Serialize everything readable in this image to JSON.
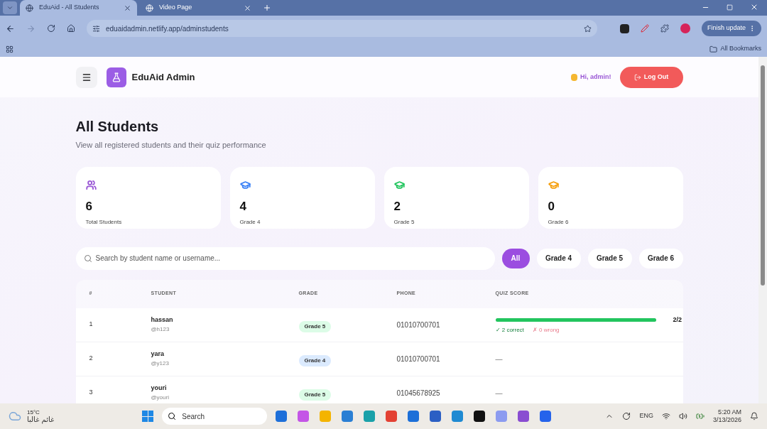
{
  "browser": {
    "tabs": [
      {
        "title": "EduAid - All Students",
        "selected": true
      },
      {
        "title": "Video Page",
        "selected": false
      }
    ],
    "address": "eduaidadmin.netlify.app/adminstudents",
    "update_button": "Finish update",
    "bookmarks": "All Bookmarks"
  },
  "header": {
    "brand": "EduAid Admin",
    "greeting": "Hi, admin!",
    "logout": "Log Out"
  },
  "page": {
    "title": "All Students",
    "subtitle": "View all registered students and their quiz performance"
  },
  "stats": [
    {
      "value": "6",
      "label": "Total Students",
      "color": "#9b59d6",
      "kind": "users"
    },
    {
      "value": "4",
      "label": "Grade 4",
      "color": "#3b82f6",
      "kind": "grad"
    },
    {
      "value": "2",
      "label": "Grade 5",
      "color": "#22c55e",
      "kind": "grad"
    },
    {
      "value": "0",
      "label": "Grade 6",
      "color": "#f59e0b",
      "kind": "grad"
    }
  ],
  "search": {
    "placeholder": "Search by student name or username..."
  },
  "filters": [
    {
      "label": "All",
      "selected": true
    },
    {
      "label": "Grade 4",
      "selected": false
    },
    {
      "label": "Grade 5",
      "selected": false
    },
    {
      "label": "Grade 6",
      "selected": false
    }
  ],
  "table": {
    "columns": [
      "#",
      "STUDENT",
      "GRADE",
      "PHONE",
      "QUIZ SCORE"
    ],
    "rows": [
      {
        "index": "1",
        "name": "hassan",
        "username": "@h123",
        "grade": "Grade 5",
        "color": "#dcfce7",
        "phone": "01010700701",
        "quiz": {
          "kind": "bar",
          "level": 1,
          "score": "2/2",
          "correct": "✓ 2 correct",
          "wrong": "✗ 0 wrong"
        }
      },
      {
        "index": "2",
        "name": "yara",
        "username": "@y123",
        "grade": "Grade 4",
        "color": "#dbeafe",
        "phone": "01010700701",
        "quiz": {
          "kind": "none",
          "text": "—"
        }
      },
      {
        "index": "3",
        "name": "youri",
        "username": "@youri",
        "grade": "Grade 5",
        "color": "#dcfce7",
        "phone": "01045678925",
        "quiz": {
          "kind": "none",
          "text": "—"
        }
      }
    ]
  },
  "taskbar": {
    "temperature": "15°C",
    "condition": "غائم غالبا",
    "search": "Search",
    "language": "ENG",
    "time": "5:20 AM",
    "date": "3/13/2026"
  }
}
